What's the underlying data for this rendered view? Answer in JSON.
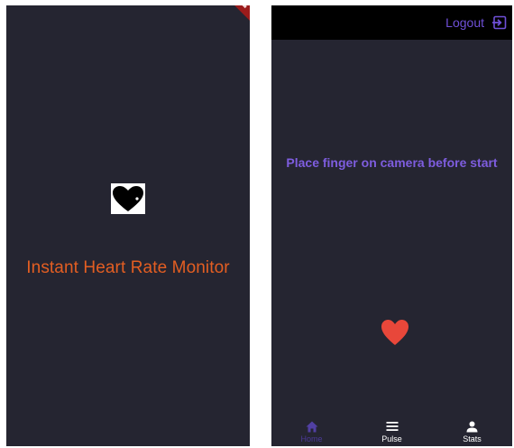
{
  "splash": {
    "title": "Instant Heart Rate Monitor",
    "title_color": "#e35e22",
    "logo_icon": "heart-icon"
  },
  "main": {
    "appbar": {
      "logout_label": "Logout",
      "logout_icon": "logout-icon"
    },
    "instruction": "Place finger on camera before start",
    "heart_icon": "heart-icon",
    "heart_color": "#e8473a",
    "bottom_nav": [
      {
        "label": "Home",
        "icon": "home-icon",
        "active": true
      },
      {
        "label": "Pulse",
        "icon": "menu-icon",
        "active": false
      },
      {
        "label": "Stats",
        "icon": "person-icon",
        "active": false
      }
    ]
  },
  "colors": {
    "background": "#252531",
    "accent": "#7e5ddf",
    "active_nav": "#4b3a97"
  }
}
